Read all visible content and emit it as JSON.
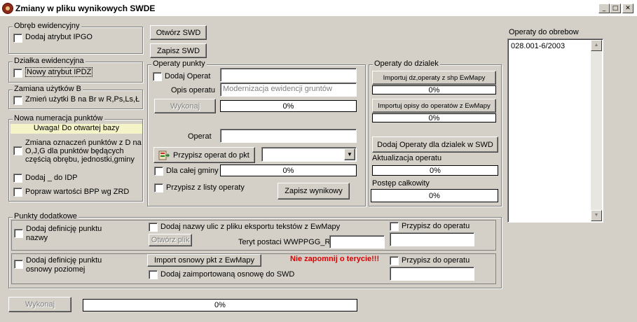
{
  "window": {
    "title": "Zmiany w pliku wynikowych SWDE"
  },
  "obreb": {
    "title": "Obręb ewidencyjny",
    "cb_label": "Dodaj atrybut IPGO"
  },
  "dzialka": {
    "title": "Działka ewidencyjna",
    "cb_label": "Nowy atrybut IPDZ"
  },
  "uzytki": {
    "title": "Zamiana użytków B",
    "cb_label": "Zmień użytki B na Br w R,Ps,Ls,Ł"
  },
  "numeracja": {
    "title": "Nowa numeracja punktów",
    "notice": "Uwaga! Do otwartej bazy",
    "cb1_lines": [
      "Zmiana oznaczeń punktów z D na",
      "O,J,G dla punktów będących",
      "częścią obrębu, jednostki,gminy"
    ],
    "cb2_label": "Dodaj _ do IDP",
    "cb3_label": "Popraw wartości BPP wg ZRD"
  },
  "buttons": {
    "open_swd": "Otwórz SWD",
    "save_swd": "Zapisz SWD"
  },
  "operaty_punkty": {
    "title": "Operaty punkty",
    "add_label": "Dodaj Operat",
    "add_value": "",
    "opis_label": "Opis operatu",
    "opis_placeholder": "Modernizacja ewidencji gruntów",
    "wykonaj": "Wykonaj",
    "progress": "0%",
    "operat_label": "Operat",
    "operat_value": "",
    "assign_btn": "Przypisz operat do pkt",
    "select_value": "",
    "gmina_label": "Dla całej gminy",
    "gmina_progress": "0%",
    "list_label": "Przypisz z listy operaty",
    "save_results": "Zapisz wynikowy"
  },
  "operaty_dzialek": {
    "title": "Operaty do dzialek",
    "import_shp": "Importuj dz,operaty z shp EwMapy",
    "progress1": "0%",
    "import_opisy": "Importuj opisy do operatów z EwMapy",
    "progress2": "0%",
    "add_swd": "Dodaj Operaty dla dzialek w SWD",
    "aktualizacja_label": "Aktualizacja operatu",
    "progress3": "0%",
    "postep_label": "Postęp całkowity",
    "progress4": "0%"
  },
  "obrebow": {
    "title": "Operaty do obrebow",
    "items": [
      "028.001-6/2003"
    ]
  },
  "punkty_dodatkowe": {
    "title": "Punkty dodatkowe",
    "row1": {
      "def_lines": [
        "Dodaj definicję punktu",
        "nazwy"
      ],
      "ulic_label": "Dodaj nazwy ulic z pliku eksportu tekstów z EwMapy",
      "open_file": "Otwórz plik",
      "teryt_label": "Teryt postaci WWPPGG_R",
      "teryt_value": "",
      "przypisz_label": "Przypisz do operatu",
      "przypisz_value": ""
    },
    "row2": {
      "def_lines": [
        "Dodaj definicję punktu",
        "osnowy poziomej"
      ],
      "import_btn": "Import osnowy pkt z EwMapy",
      "warning": "Nie zapomnij o terycie!!!",
      "add_label": "Dodaj zaimportowaną osnowę do SWD",
      "przypisz_label": "Przypisz do operatu",
      "przypisz_value": ""
    }
  },
  "footer": {
    "wykonaj": "Wykonaj",
    "progress": "0%"
  }
}
